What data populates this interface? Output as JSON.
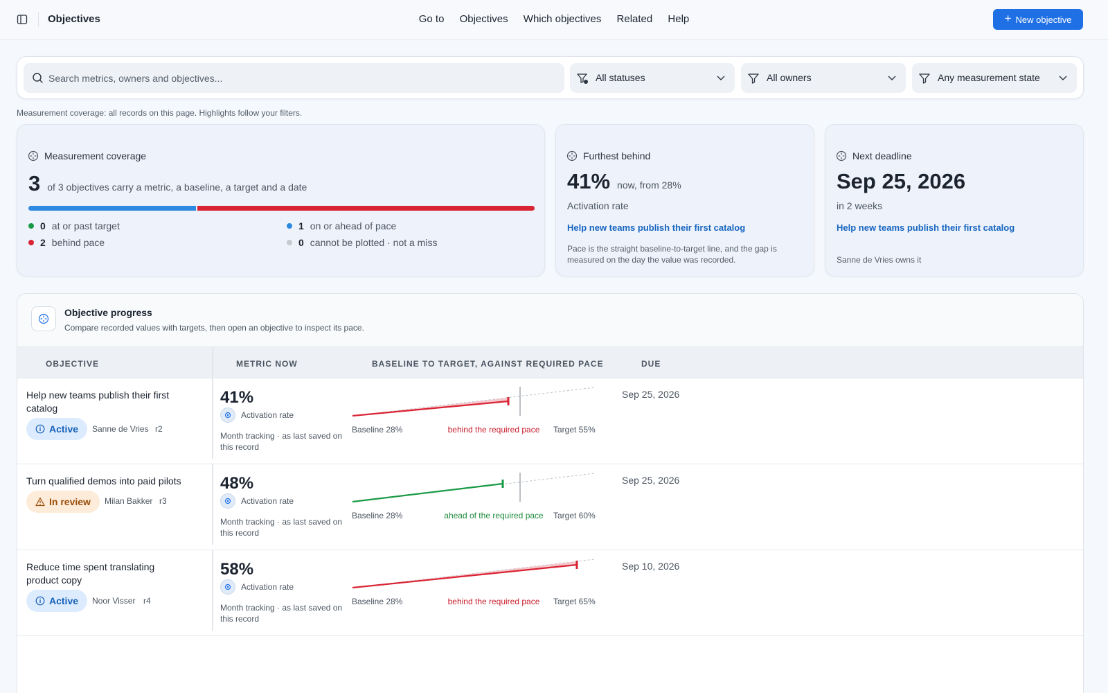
{
  "app": {
    "title": "Objectives",
    "nav": [
      "Go to",
      "Objectives",
      "Which objectives",
      "Related",
      "Help"
    ],
    "new_button": "New objective",
    "accent": "#1f6fe5"
  },
  "filters": {
    "search_placeholder": "Search metrics, owners and objectives...",
    "status": "All statuses",
    "owners": "All owners",
    "measurement": "Any measurement state"
  },
  "coverage_note": "Measurement coverage: all records on this page. Highlights follow your filters.",
  "coverage_card": {
    "title": "Measurement coverage",
    "count": "3",
    "summary": "of 3 objectives carry a metric, a baseline, a target and a date",
    "legend": [
      {
        "count": "0",
        "label": "at or past target",
        "color": "#1a9a46"
      },
      {
        "count": "1",
        "label": "on or ahead of pace",
        "color": "#2d8ae0"
      },
      {
        "count": "2",
        "label": "behind pace",
        "color": "#d92434"
      },
      {
        "count": "0",
        "label": "cannot be plotted · not a miss",
        "color": "#c5cad1"
      }
    ],
    "bar_fractions": {
      "ahead": 0.333,
      "behind": 0.667
    }
  },
  "behind_card": {
    "title": "Furthest behind",
    "value": "41%",
    "from": "now, from 28%",
    "metric": "Activation rate",
    "link": "Help new teams publish their first catalog",
    "note": "Pace is the straight baseline-to-target line, and the gap is measured on the day the value was recorded."
  },
  "deadline_card": {
    "title": "Next deadline",
    "date": "Sep 25, 2026",
    "relative": "in 2 weeks",
    "link": "Help new teams publish their first catalog",
    "owner_note": "Sanne de Vries owns it"
  },
  "progress": {
    "title": "Objective progress",
    "subtitle": "Compare recorded values with targets, then open an objective to inspect its pace.",
    "columns": [
      "OBJECTIVE",
      "METRIC NOW",
      "BASELINE TO TARGET, AGAINST REQUIRED PACE",
      "DUE"
    ],
    "rows": [
      {
        "title": "Help new teams publish their first catalog",
        "status": "Active",
        "owner": "Sanne de Vries",
        "rev": "r2",
        "value": "41%",
        "metric": "Activation rate",
        "note": "Month tracking · as last saved on this record",
        "baseline": "Baseline 28%",
        "pace": "behind the required pace",
        "target": "Target 55%",
        "due": "Sep 25, 2026"
      },
      {
        "title": "Turn qualified demos into paid pilots",
        "status": "In review",
        "owner": "Milan Bakker",
        "rev": "r3",
        "value": "48%",
        "metric": "Activation rate",
        "note": "Month tracking · as last saved on this record",
        "baseline": "Baseline 28%",
        "pace": "ahead of the required pace",
        "target": "Target 60%",
        "due": "Sep 25, 2026"
      },
      {
        "title": "Reduce time spent translating product copy",
        "status": "Active",
        "owner": "Noor Visser",
        "rev": "r4",
        "value": "58%",
        "metric": "Activation rate",
        "note": "Month tracking · as last saved on this record",
        "baseline": "Baseline 28%",
        "pace": "behind the required pace",
        "target": "Target 65%",
        "due": "Sep 10, 2026"
      }
    ]
  }
}
